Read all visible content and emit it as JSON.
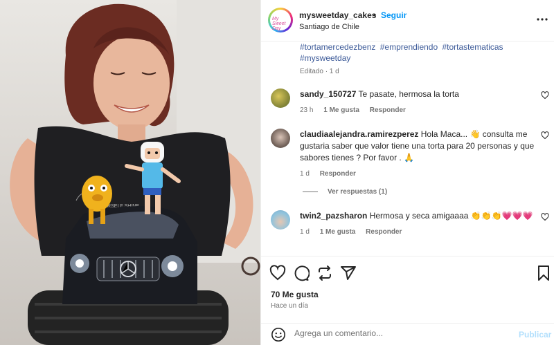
{
  "header": {
    "username": "mysweetday_cakes",
    "separator": "•",
    "follow_label": "Seguir",
    "location": "Santiago de Chile",
    "avatar_text": "My Sweet Day"
  },
  "caption": {
    "hashtags": [
      "#tortamercedezbenz",
      "#emprendiendo",
      "#tortastematicas",
      "#mysweetday"
    ],
    "edited": "Editado · 1 d"
  },
  "comments": [
    {
      "user": "sandy_150727",
      "text": "Te pasate, hermosa la torta",
      "time": "23 h",
      "likes": "1 Me gusta",
      "reply": "Responder"
    },
    {
      "user": "claudiaalejandra.ramirezperez",
      "text": "Hola Maca... 👋 consulta me gustaria saber que valor tiene una torta para 20 personas y que sabores tienes ? Por favor . 🙏",
      "time": "1 d",
      "reply": "Responder"
    },
    {
      "user": "twin2_pazsharon",
      "text": "Hermosa y seca amigaaaa 👏👏👏💗💗💗",
      "time": "1 d",
      "likes": "1 Me gusta",
      "reply": "Responder"
    }
  ],
  "view_replies": "Ver respuestas (1)",
  "actions": {
    "likes": "70 Me gusta",
    "time": "Hace un día",
    "comment_placeholder": "Agrega un comentario...",
    "publish_label": "Publicar"
  },
  "icons": {
    "more": "more-options-icon",
    "heart": "heart-icon",
    "comment": "comment-icon",
    "share": "share-icon",
    "send": "send-icon",
    "save": "bookmark-icon",
    "emoji": "emoji-icon"
  },
  "colors": {
    "follow": "#0095f6",
    "hashtag": "#3b5998",
    "muted": "#737373",
    "publish_disabled": "#b2dffc"
  }
}
